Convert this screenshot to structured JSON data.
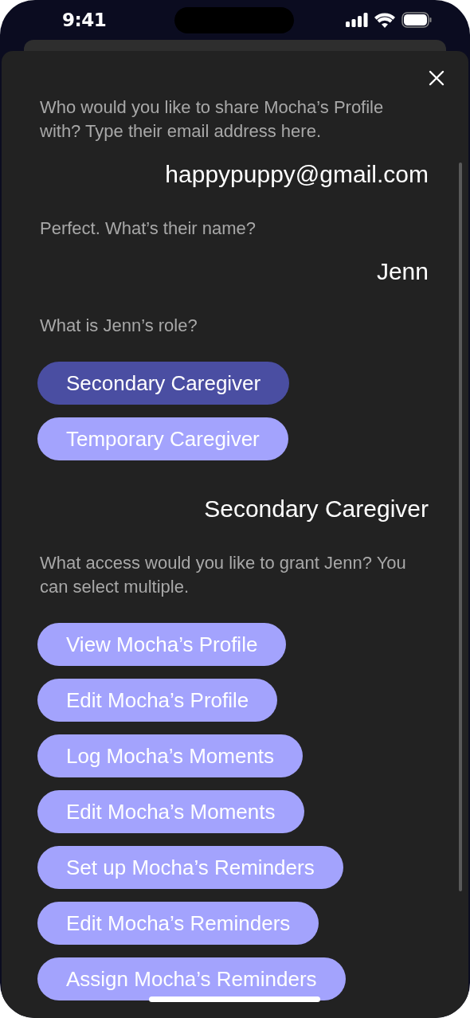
{
  "status_bar": {
    "time": "9:41"
  },
  "conversation": [
    {
      "kind": "question",
      "text": "Who would you like to share Mocha’s Profile with? Type their email address here."
    },
    {
      "kind": "answer",
      "text": "happypuppy@gmail.com"
    },
    {
      "kind": "question",
      "text": "Perfect. What’s their name?"
    },
    {
      "kind": "answer",
      "text": "Jenn"
    },
    {
      "kind": "question",
      "text": "What is Jenn’s role?"
    },
    {
      "kind": "choices",
      "options": [
        {
          "label": "Secondary Caregiver",
          "selected": true
        },
        {
          "label": "Temporary Caregiver",
          "selected": false
        }
      ]
    },
    {
      "kind": "answer",
      "text": "Secondary Caregiver"
    },
    {
      "kind": "question",
      "text": "What access would you like to grant Jenn? You can select multiple."
    },
    {
      "kind": "choices",
      "options": [
        {
          "label": "View Mocha’s Profile",
          "selected": false
        },
        {
          "label": "Edit Mocha’s Profile",
          "selected": false
        },
        {
          "label": "Log Mocha’s Moments",
          "selected": false
        },
        {
          "label": "Edit Mocha’s Moments",
          "selected": false
        },
        {
          "label": "Set up Mocha’s Reminders",
          "selected": false
        },
        {
          "label": "Edit Mocha’s Reminders",
          "selected": false
        },
        {
          "label": "Assign Mocha’s Reminders",
          "selected": false
        }
      ]
    }
  ]
}
